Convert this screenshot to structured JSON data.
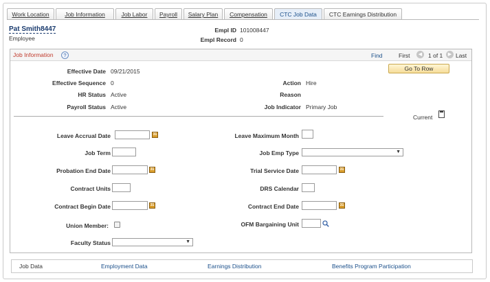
{
  "tabs": [
    {
      "label": "Work Location",
      "active": false
    },
    {
      "label": "Job Information",
      "active": false
    },
    {
      "label": "Job Labor",
      "active": false
    },
    {
      "label": "Payroll",
      "active": false
    },
    {
      "label": "Salary Plan",
      "active": false
    },
    {
      "label": "Compensation",
      "active": false
    },
    {
      "label": "CTC Job Data",
      "active": true
    },
    {
      "label": "CTC Earnings Distribution",
      "active": false
    }
  ],
  "employee": {
    "name": "Pat Smith8447",
    "role": "Employee",
    "empl_id_label": "Empl ID",
    "empl_id": "101008447",
    "empl_record_label": "Empl Record",
    "empl_record": "0"
  },
  "panel": {
    "title": "Job Information",
    "help": "?",
    "find": "Find",
    "first": "First",
    "count": "1 of 1",
    "last": "Last",
    "go_to_row": "Go To Row",
    "current_label": "Current"
  },
  "summary": {
    "effective_date_label": "Effective Date",
    "effective_date": "09/21/2015",
    "effective_sequence_label": "Effective Sequence",
    "effective_sequence": "0",
    "action_label": "Action",
    "action": "Hire",
    "hr_status_label": "HR Status",
    "hr_status": "Active",
    "reason_label": "Reason",
    "reason": "",
    "payroll_status_label": "Payroll Status",
    "payroll_status": "Active",
    "job_indicator_label": "Job Indicator",
    "job_indicator": "Primary Job"
  },
  "form": {
    "leave_accrual_date": "Leave Accrual Date",
    "leave_maximum_month": "Leave Maximum Month",
    "job_term": "Job Term",
    "job_emp_type": "Job Emp Type",
    "probation_end_date": "Probation End Date",
    "trial_service_date": "Trial Service Date",
    "contract_units": "Contract Units",
    "drs_calendar": "DRS Calendar",
    "contract_begin_date": "Contract Begin Date",
    "contract_end_date": "Contract End Date",
    "union_member": "Union Member:",
    "ofm_bargaining_unit": "OFM Bargaining Unit",
    "faculty_status": "Faculty Status"
  },
  "bottom_links": [
    {
      "label": "Job Data"
    },
    {
      "label": "Employment Data"
    },
    {
      "label": "Earnings Distribution"
    },
    {
      "label": "Benefits Program Participation"
    }
  ],
  "colors": {
    "panel_title": "#c0392b",
    "link": "#1a4f8a",
    "button_bg": "#f6dd9a"
  }
}
